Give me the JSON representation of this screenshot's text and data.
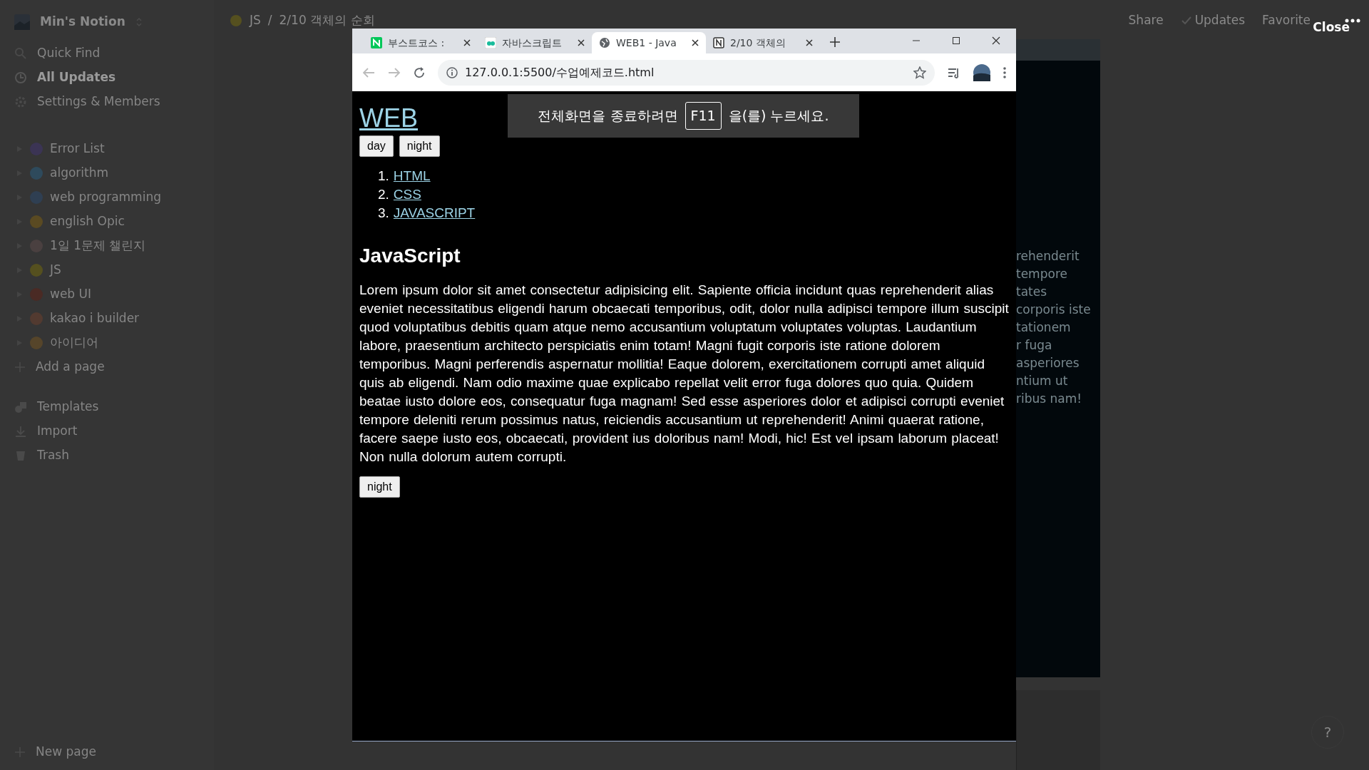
{
  "sidebar": {
    "workspace": "Min's Notion",
    "nav": [
      {
        "label": "Quick Find",
        "kind": "search",
        "selected": false
      },
      {
        "label": "All Updates",
        "kind": "clock",
        "selected": true
      },
      {
        "label": "Settings & Members",
        "kind": "gear",
        "selected": false
      }
    ],
    "pages": [
      {
        "title": "Error List",
        "color": "#3b3454"
      },
      {
        "title": "algorithm",
        "color": "#2e4a5c"
      },
      {
        "title": "web programming",
        "color": "#2f3f52"
      },
      {
        "title": "english Opic",
        "color": "#5a4a22"
      },
      {
        "title": "1일 1문제 챌린지",
        "color": "#4a4040"
      },
      {
        "title": "JS",
        "color": "#55501f"
      },
      {
        "title": "web UI",
        "color": "#4a2a24"
      },
      {
        "title": "kakao i builder",
        "color": "#523a30"
      },
      {
        "title": "아이디어",
        "color": "#56452a"
      }
    ],
    "add_page": "Add a page",
    "tools": [
      {
        "label": "Templates",
        "kind": "shapes"
      },
      {
        "label": "Import",
        "kind": "download"
      },
      {
        "label": "Trash",
        "kind": "trash"
      }
    ],
    "new_page": "New page"
  },
  "topbar": {
    "breadcrumb": [
      "JS",
      "2/10 객체의 순회"
    ],
    "separator": "/",
    "actions": [
      "Share",
      "Updates",
      "Favorite"
    ],
    "close": "Close"
  },
  "browser": {
    "tabs": [
      {
        "title": "부스트코스 :",
        "kind": "n",
        "selected": false
      },
      {
        "title": "자바스크립트",
        "kind": "bc",
        "selected": false
      },
      {
        "title": "WEB1 - Java",
        "kind": "globe",
        "selected": true
      },
      {
        "title": "2/10 객체의",
        "kind": "notion",
        "selected": false
      }
    ],
    "url": "127.0.0.1:5500/수업예제코드.html",
    "notice": {
      "before": "전체화면을 종료하려면",
      "key": "F11",
      "after": "을(를) 누르세요."
    },
    "page": {
      "title": "WEB",
      "buttons": [
        "day",
        "night"
      ],
      "links": [
        {
          "number": "1.",
          "label": "HTML"
        },
        {
          "number": "2.",
          "label": "CSS"
        },
        {
          "number": "3.",
          "label": "JAVASCRIPT"
        }
      ],
      "heading": "JavaScript",
      "paragraph": "Lorem ipsum dolor sit amet consectetur adipisicing elit. Sapiente officia incidunt quas reprehenderit alias eveniet necessitatibus eligendi harum obcaecati temporibus, odit, dolor nulla adipisci tempore illum suscipit quod voluptatibus debitis quam atque nemo accusantium voluptatum voluptates voluptas. Laudantium labore, praesentium architecto perspiciatis enim totam! Magni fugit corporis iste ratione dolorem temporibus. Magni perferendis aspernatur mollitia! Eaque dolorem, exercitationem corrupti amet aliquid quis ab eligendi. Nam odio maxime quae explicabo repellat velit error fuga dolores quo quia. Quidem beatae iusto dolore eos, consequatur fuga magnam! Sed esse asperiores dolor et adipisci corrupti eveniet tempore deleniti rerum possimus natus, reiciendis accusantium ut reprehenderit! Animi quaerat ratione, facere saepe iusto eos, obcaecati, provident ius doloribus nam! Modi, hic! Est vel ipsam laborum placeat! Non nulla dolorum autem corrupti.",
      "bottom_button": "night"
    }
  },
  "behind": {
    "fragments": [
      "rehenderit",
      "tempore",
      "tates",
      "corporis iste",
      "tationem",
      "r fuga",
      "asperiores",
      "ntium ut",
      "ribus nam!"
    ]
  },
  "help": "?"
}
